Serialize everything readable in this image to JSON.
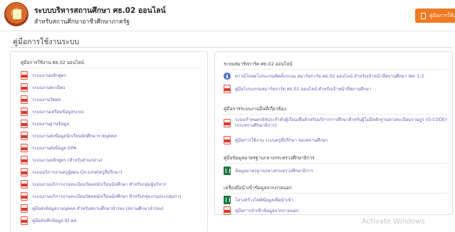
{
  "header": {
    "title": "ระบบบริหารสถานศึกษา ศธ.02 ออนไลน์",
    "subtitle": "สำหรับสถานศึกษาอาชีวศึกษาภาครัฐ",
    "manual_button": "คู่มือการใช้งาน"
  },
  "page": {
    "section_title": "คู่มือการใช้งานระบบ"
  },
  "left_panel": {
    "heading": "คู่มือการใช้งาน ศธ.02 ออนไลน์",
    "items": [
      {
        "label": "ระบบงานหลักสูตร",
        "icon": "pdf-icon"
      },
      {
        "label": "ระบบงานทะเบียน",
        "icon": "pdf-icon"
      },
      {
        "label": "ระบบงานวัดผล",
        "icon": "pdf-icon"
      },
      {
        "label": "ระบบงานเตรียมข้อมูลระบบ",
        "icon": "pdf-icon"
      },
      {
        "label": "ระบบงานฐานข้อมูล",
        "icon": "pdf-icon"
      },
      {
        "label": "ระบบงานส่งข้อมูลนักเรียนนักศึกษารายบุคคล",
        "icon": "pdf-icon"
      },
      {
        "label": "ระบบงานส่งข้อมูล GPA",
        "icon": "pdf-icon"
      },
      {
        "label": "ระบบงานหลักสูตร (สำหรับส่วนกลาง)",
        "icon": "pdf-icon"
      },
      {
        "label": "ระบบบริการงานครูผู้สอน On-Line(ครูที่ปรึกษา)",
        "icon": "pdf-icon"
      },
      {
        "label": "ระบบงานบริการงานทะเบียนวัดผลนักเรียนนักศึกษา สำหรับกลุ่มผู้บริหาร",
        "icon": "pdf-icon"
      },
      {
        "label": "ระบบงานบริการงานทะเบียนวัดผลนักเรียนนักศึกษา สำหรับกลุ่มงานประกอบการ",
        "icon": "pdf-icon"
      },
      {
        "label": "คู่มือส่งข้อมูลรายบุคคล สำหรับสถานศึกษานำร่อง (สถานศึกษานำร่อง)",
        "icon": "pdf-icon"
      },
      {
        "label": "คู่มือบันทึกข้อมูล ID พล",
        "icon": "pdf-icon"
      }
    ]
  },
  "right_panel": {
    "groups": [
      {
        "heading": "ระบบสมาร์ทการ์ด ศธ.02 ออนไลน์",
        "items": [
          {
            "label": "ดาวน์โหลดโปรแกรมติดตั้งระบบ สมาร์ทการ์ด ศธ.02 ออนไลน์ สำหรับเจ้าหน้าที่สถานศึกษา Ver 1.3",
            "icon": "info-icon"
          },
          {
            "label": "คู่มือโปรแกรมสมาร์ทการ์ด ศธ.02 ออนไลน์ สำหรับเจ้าหน้าที่สถานศึกษา",
            "icon": "pdf-icon"
          }
        ]
      },
      {
        "heading": "คู่มือการระบบงานอื่นที่เกี่ยวข้อง",
        "items": [
          {
            "label": "ระบบกำหนดรหัสประจำตัวผู้เรียนเพื่อสำหรับบริการการศึกษาสำหรับผู้ไม่มีหลักฐานทางทะเบียนราษฎร (G-CODE) (กระทรวงศึกษาธิการ)",
            "icon": "pdf-icon"
          },
          {
            "label": "คู่มือการใช้งาน ระบบครูที่ปรึกษา ของสถานศึกษา",
            "icon": "pdf-icon"
          }
        ]
      },
      {
        "heading": "คู่มือข้อมูลมาตรฐานกลางกระทรวงศึกษาธิการ",
        "items": [
          {
            "label": "ข้อมูลมาตรฐานกลางกระทรวงศึกษาธิการ",
            "icon": "xls-icon"
          }
        ]
      },
      {
        "heading": "เครื่องมือนำเข้าข้อมูลจากภายนอก",
        "items": [
          {
            "label": "โครงสร้างไฟล์ข้อมูลเพื่อนำเข้า",
            "icon": "xls-icon"
          },
          {
            "label": "คู่มือการนำเข้าข้อมูลจากภายนอก",
            "icon": "pdf-icon"
          }
        ]
      }
    ]
  },
  "watermark": "Activate Windows"
}
